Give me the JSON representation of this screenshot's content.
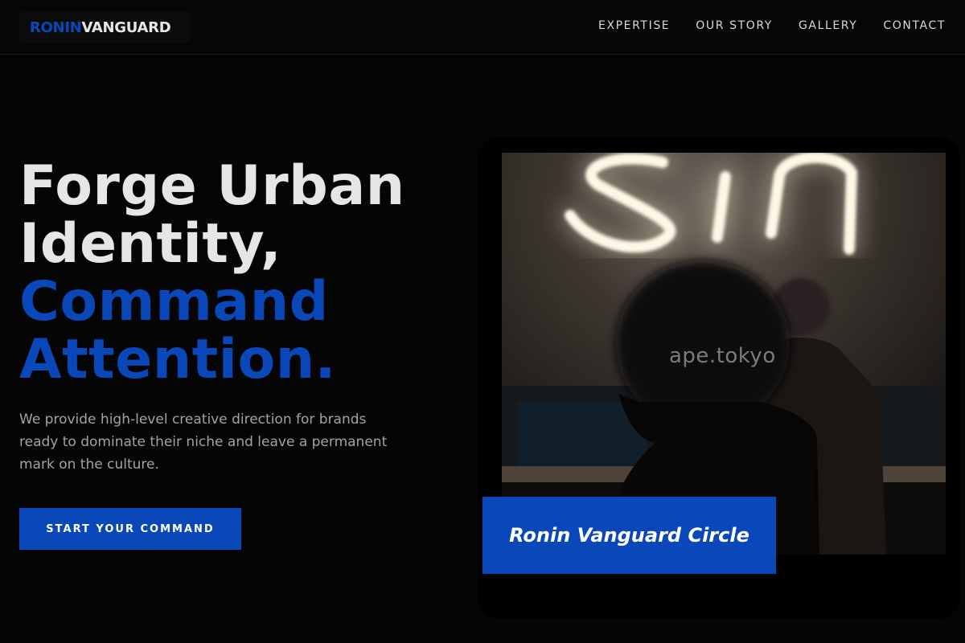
{
  "header": {
    "logo": {
      "part1": "RONIN",
      "part2": "VANGUARD"
    },
    "nav": [
      "EXPERTISE",
      "OUR STORY",
      "GALLERY",
      "CONTACT"
    ]
  },
  "hero": {
    "title_lines": [
      "Forge Urban",
      "Identity,",
      "Command",
      "Attention."
    ],
    "description": "We provide high-level creative direction for brands ready to dominate their niche and leave a permanent mark on the culture.",
    "cta_label": "START YOUR COMMAND",
    "image": {
      "watermark": "ape.tokyo",
      "neon_sign": "sin",
      "badge": "Ronin Vanguard Circle"
    }
  },
  "colors": {
    "accent": "#0a47b8",
    "background": "#050505",
    "text": "#e6e6e6",
    "muted": "#a3a3a3"
  }
}
